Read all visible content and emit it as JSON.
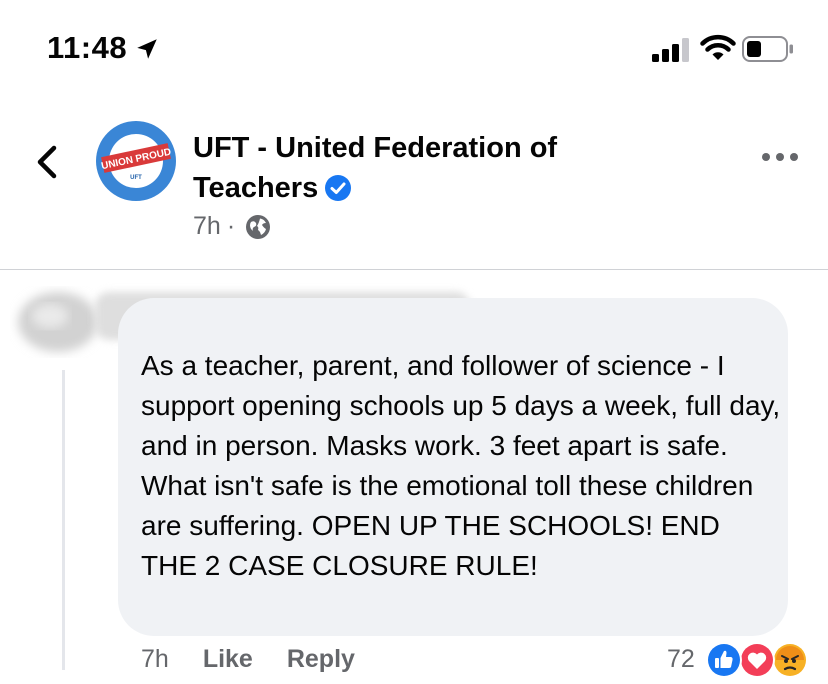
{
  "status_bar": {
    "time": "11:48",
    "location_icon": "location-arrow-icon",
    "signal_icon": "cellular-signal-icon",
    "wifi_icon": "wifi-icon",
    "battery_icon": "battery-icon"
  },
  "header": {
    "back_icon": "chevron-left-icon",
    "avatar_text": "UNION PROUD",
    "avatar_subtext": "UFT",
    "page_name": "UFT - United Federation of Teachers",
    "verified_icon": "verified-badge-icon",
    "post_time": "7h",
    "separator": "·",
    "globe_icon": "globe-icon",
    "more_icon": "more-horizontal-icon"
  },
  "comment": {
    "text": "As a teacher, parent, and follower of science - I support opening schools up 5 days a week, full day, and in person. Masks work. 3 feet apart is safe. What isn't safe is the emotional toll these children are suffering. OPEN UP THE SCHOOLS! END THE 2 CASE CLOSURE RULE!",
    "time": "7h",
    "like_label": "Like",
    "reply_label": "Reply",
    "reaction_count": "72",
    "reactions": [
      "like-reaction-icon",
      "love-reaction-icon",
      "angry-reaction-icon"
    ]
  },
  "colors": {
    "facebook_blue": "#1877f2",
    "secondary_text": "#65676b",
    "bubble": "#f0f2f5",
    "love_red": "#f33e58",
    "angry_orange": "#f7b125"
  }
}
